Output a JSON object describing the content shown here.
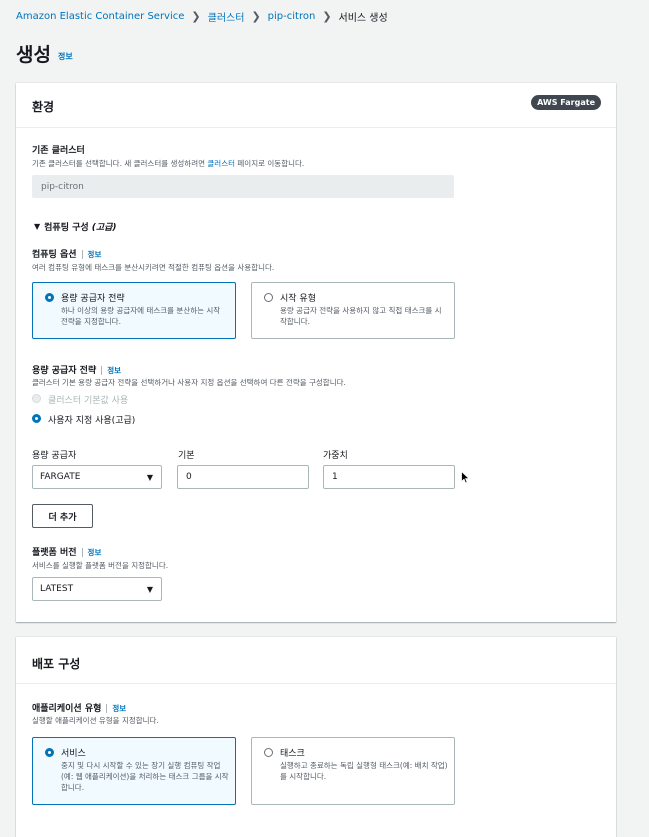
{
  "breadcrumb": {
    "items": [
      "Amazon Elastic Container Service",
      "클러스터",
      "pip-citron"
    ],
    "current": "서비스 생성",
    "separator": "❯"
  },
  "page": {
    "title": "생성",
    "info": "정보"
  },
  "env": {
    "title": "환경",
    "badge": "AWS Fargate",
    "existing_cluster_label": "기존 클러스터",
    "existing_cluster_desc_pre": "기존 클러스터를 선택합니다. 새 클러스터를 생성하려면",
    "existing_cluster_desc_link": "클러스터",
    "existing_cluster_desc_post": "페이지로 이동합니다.",
    "cluster_value": "pip-citron",
    "compute_toggle": "컴퓨팅 구성",
    "compute_toggle_advanced": "(고급)",
    "compute_options_label": "컴퓨팅 옵션",
    "compute_options_info": "정보",
    "compute_options_desc": "여러 컴퓨팅 유형에 태스크를 분산시키려면 적절한 컴퓨팅 옵션을 사용합니다.",
    "tiles": [
      {
        "title": "용량 공급자 전략",
        "desc": "하나 이상의 용량 공급자에 태스크를 분산하는 시작 전략을 지정합니다."
      },
      {
        "title": "시작 유형",
        "desc": "용량 공급자 전략을 사용하지 않고 직접 태스크를 시작합니다."
      }
    ],
    "cps_label": "용량 공급자 전략",
    "cps_info": "정보",
    "cps_desc": "클러스터 기본 용량 공급자 전략을 선택하거나 사용자 지정 옵션을 선택하여 다른 전략을 구성합니다.",
    "radio_default": "클러스터 기본값 사용",
    "radio_custom": "사용자 지정 사용(고급)",
    "col_provider": "용량 공급자",
    "col_base": "기본",
    "col_weight": "가중치",
    "provider_value": "FARGATE",
    "base_value": "0",
    "weight_value": "1",
    "add_more": "더 추가",
    "platform_label": "플랫폼 버전",
    "platform_info": "정보",
    "platform_desc": "서비스를 실행할 플랫폼 버전을 지정합니다.",
    "platform_value": "LATEST"
  },
  "deploy": {
    "title": "배포 구성",
    "app_type_label": "애플리케이션 유형",
    "app_type_info": "정보",
    "app_type_desc": "실행할 애플리케이션 유형을 지정합니다.",
    "tiles": [
      {
        "title": "서비스",
        "desc": "중지 및 다시 시작할 수 있는 장기 실행 컴퓨팅 작업(예: 웹 애플리케이션)을 처리하는 태스크 그룹을 시작합니다."
      },
      {
        "title": "태스크",
        "desc": "실행하고 종료하는 독립 실행형 태스크(예: 배치 작업)를 시작합니다."
      }
    ]
  }
}
